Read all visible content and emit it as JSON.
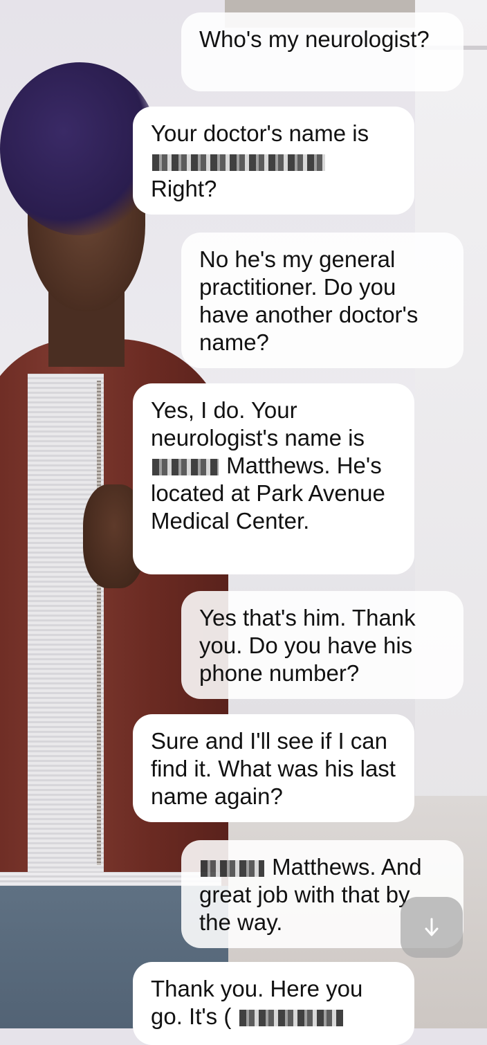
{
  "messages": [
    {
      "role": "user",
      "parts": [
        "Who's my neurologist?"
      ]
    },
    {
      "role": "assistant",
      "parts": [
        "Your doctor's name is",
        "Right?"
      ]
    },
    {
      "role": "user",
      "parts": [
        "No he's my general practitioner. Do you have another doctor's name?"
      ]
    },
    {
      "role": "assistant",
      "parts": [
        "Yes, I do. Your neurologist's name is",
        "Matthews. He's located at Park Avenue Medical Center."
      ]
    },
    {
      "role": "user",
      "parts": [
        "Yes that's him. Thank you. Do you have his phone number?"
      ]
    },
    {
      "role": "assistant",
      "parts": [
        "Sure and I'll see if I can find it. What was his last name again?"
      ]
    },
    {
      "role": "user",
      "parts": [
        "Matthews. And great job with that by the way."
      ]
    },
    {
      "role": "assistant",
      "parts": [
        "Thank you. Here you go. It's ("
      ]
    }
  ],
  "scroll_button": {
    "icon": "arrow-down-icon"
  },
  "colors": {
    "user_bubble": "#ffffffe0",
    "bot_bubble": "#ffffff",
    "text": "#111111",
    "scroll_button": "#aaaaaa"
  }
}
